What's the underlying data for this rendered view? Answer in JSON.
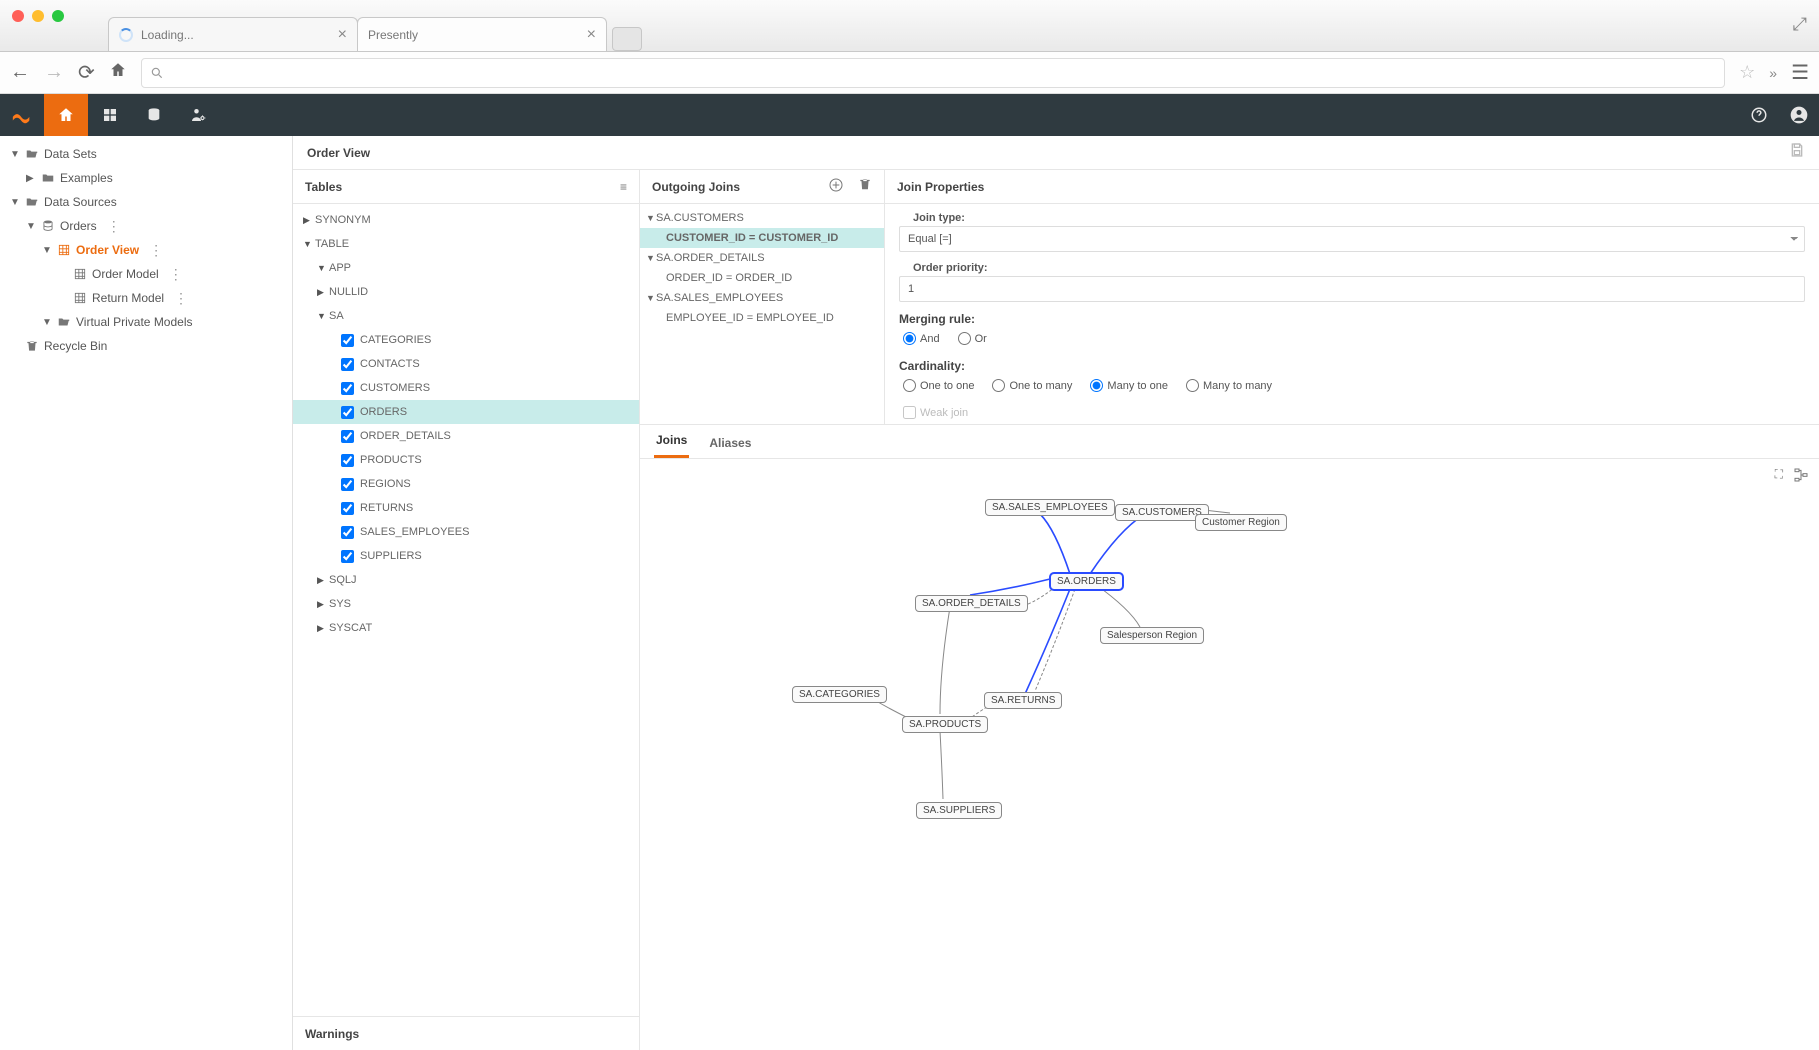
{
  "browser": {
    "tabs": [
      {
        "title": "Loading...",
        "loading": true
      },
      {
        "title": "Presently",
        "loading": false
      }
    ]
  },
  "app_nav": {
    "brand": "logo",
    "items": [
      "home",
      "dashboard",
      "data",
      "admin"
    ],
    "active": "home"
  },
  "sidebar": {
    "items": [
      {
        "label": "Data Sets",
        "depth": 0,
        "icon": "folder-open",
        "expanded": true
      },
      {
        "label": "Examples",
        "depth": 1,
        "icon": "folder",
        "expandable": true
      },
      {
        "label": "Data Sources",
        "depth": 0,
        "icon": "folder-open",
        "expanded": true
      },
      {
        "label": "Orders",
        "depth": 1,
        "icon": "db",
        "expanded": true,
        "dots": true
      },
      {
        "label": "Order View",
        "depth": 2,
        "icon": "grid",
        "selected": true,
        "expanded": true,
        "dots": true
      },
      {
        "label": "Order Model",
        "depth": 3,
        "icon": "grid",
        "dots": true
      },
      {
        "label": "Return Model",
        "depth": 3,
        "icon": "grid",
        "dots": true
      },
      {
        "label": "Virtual Private Models",
        "depth": 2,
        "icon": "folder-open",
        "expanded": true
      },
      {
        "label": "Recycle Bin",
        "depth": 0,
        "icon": "trash"
      }
    ]
  },
  "crumb": {
    "title": "Order View"
  },
  "tables": {
    "header": "Tables",
    "groups": [
      {
        "label": "SYNONYM",
        "expandable": true,
        "depth": 0
      },
      {
        "label": "TABLE",
        "expanded": true,
        "depth": 0
      },
      {
        "label": "APP",
        "expanded": true,
        "depth": 1
      },
      {
        "label": "NULLID",
        "expandable": true,
        "depth": 1
      },
      {
        "label": "SA",
        "expanded": true,
        "depth": 1
      },
      {
        "label": "CATEGORIES",
        "check": true,
        "depth": 2
      },
      {
        "label": "CONTACTS",
        "check": true,
        "depth": 2
      },
      {
        "label": "CUSTOMERS",
        "check": true,
        "depth": 2
      },
      {
        "label": "ORDERS",
        "check": true,
        "depth": 2,
        "selected": true
      },
      {
        "label": "ORDER_DETAILS",
        "check": true,
        "depth": 2
      },
      {
        "label": "PRODUCTS",
        "check": true,
        "depth": 2
      },
      {
        "label": "REGIONS",
        "check": true,
        "depth": 2
      },
      {
        "label": "RETURNS",
        "check": true,
        "depth": 2
      },
      {
        "label": "SALES_EMPLOYEES",
        "check": true,
        "depth": 2
      },
      {
        "label": "SUPPLIERS",
        "check": true,
        "depth": 2
      },
      {
        "label": "SQLJ",
        "expandable": true,
        "depth": 1
      },
      {
        "label": "SYS",
        "expandable": true,
        "depth": 1
      },
      {
        "label": "SYSCAT",
        "expandable": true,
        "depth": 1
      }
    ],
    "warnings": "Warnings"
  },
  "outgoing": {
    "header": "Outgoing Joins",
    "items": [
      {
        "label": "SA.CUSTOMERS",
        "group": true
      },
      {
        "label": "CUSTOMER_ID = CUSTOMER_ID",
        "selected": true
      },
      {
        "label": "SA.ORDER_DETAILS",
        "group": true
      },
      {
        "label": "ORDER_ID = ORDER_ID"
      },
      {
        "label": "SA.SALES_EMPLOYEES",
        "group": true
      },
      {
        "label": "EMPLOYEE_ID = EMPLOYEE_ID"
      }
    ]
  },
  "props": {
    "header": "Join Properties",
    "join_type_label": "Join type:",
    "join_type_value": "Equal [=]",
    "priority_label": "Order priority:",
    "priority_value": "1",
    "merging_label": "Merging rule:",
    "merging_options": [
      "And",
      "Or"
    ],
    "merging_selected": "And",
    "cardinality_label": "Cardinality:",
    "cardinality_options": [
      "One to one",
      "One to many",
      "Many to one",
      "Many to many"
    ],
    "cardinality_selected": "Many to one",
    "weak_label": "Weak join"
  },
  "diagram": {
    "tabs": [
      "Joins",
      "Aliases"
    ],
    "active": "Joins",
    "nodes": {
      "n1": "SA.SALES_EMPLOYEES",
      "n2": "SA.CUSTOMERS",
      "n3": "Customer Region",
      "n4": "SA.ORDERS",
      "n5": "SA.ORDER_DETAILS",
      "n6": "Salesperson Region",
      "n7": "SA.RETURNS",
      "n8": "SA.CATEGORIES",
      "n9": "SA.PRODUCTS",
      "n10": "SA.SUPPLIERS"
    }
  }
}
